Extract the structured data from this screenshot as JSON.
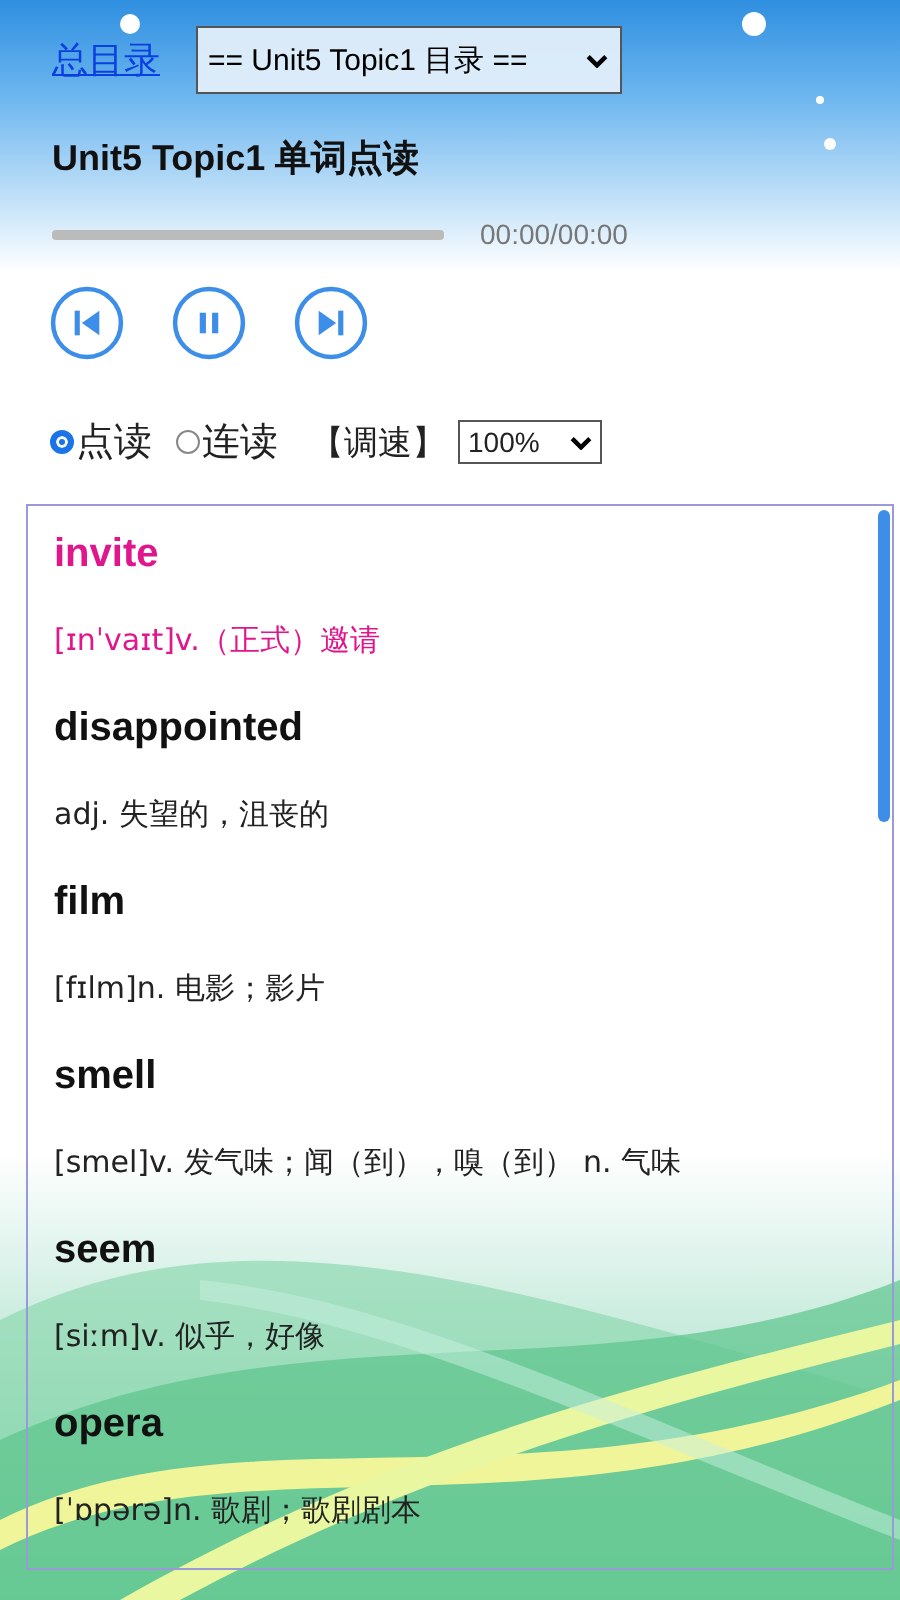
{
  "nav": {
    "home_link": "总目录",
    "unit_select": "== Unit5 Topic1 目录 =="
  },
  "title": "Unit5 Topic1 单词点读",
  "player": {
    "time": "00:00/00:00"
  },
  "modes": [
    {
      "label": "点读",
      "selected": true
    },
    {
      "label": "连读",
      "selected": false
    }
  ],
  "speed": {
    "label": "【调速】",
    "value": "100%"
  },
  "words": [
    {
      "word": "invite",
      "meaning": "[ɪnˈvaɪt]v.（正式）邀请",
      "selected": true
    },
    {
      "word": "disappointed",
      "meaning": "adj. 失望的，沮丧的",
      "selected": false
    },
    {
      "word": "film",
      "meaning": "[fɪlm]n. 电影；影片",
      "selected": false
    },
    {
      "word": "smell",
      "meaning": "[smel]v. 发气味；闻（到），嗅（到） n. 气味",
      "selected": false
    },
    {
      "word": "seem",
      "meaning": "[siːm]v. 似乎，好像",
      "selected": false
    },
    {
      "word": "opera",
      "meaning": "[ˈɒpərə]n. 歌剧；歌剧剧本",
      "selected": false
    }
  ]
}
